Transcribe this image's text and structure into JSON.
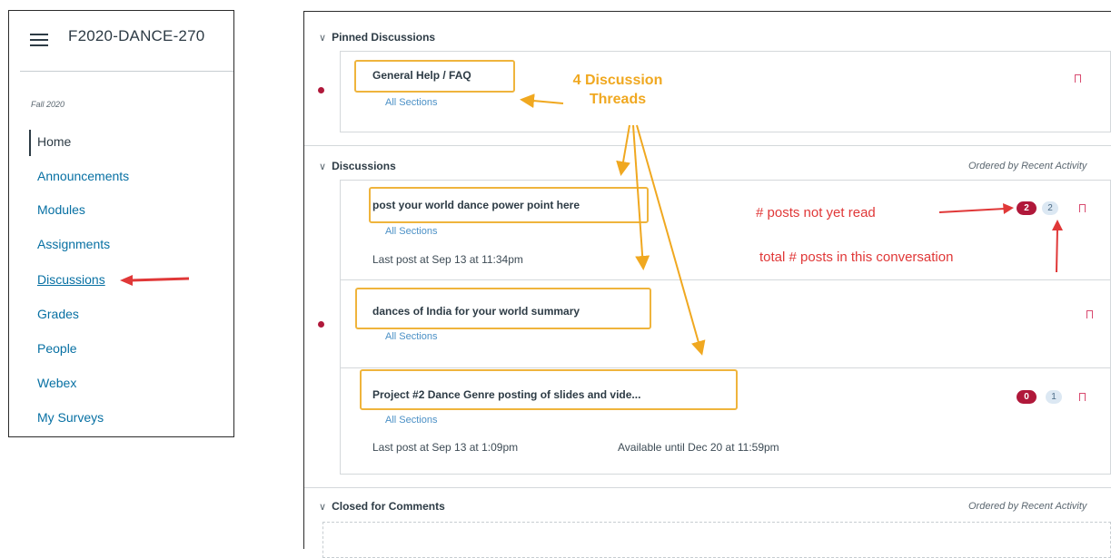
{
  "sidebar": {
    "course_title": "F2020-DANCE-270",
    "term": "Fall 2020",
    "items": [
      {
        "label": "Home"
      },
      {
        "label": "Announcements"
      },
      {
        "label": "Modules"
      },
      {
        "label": "Assignments"
      },
      {
        "label": "Discussions"
      },
      {
        "label": "Grades"
      },
      {
        "label": "People"
      },
      {
        "label": "Webex"
      },
      {
        "label": "My Surveys"
      }
    ]
  },
  "main": {
    "pinned": {
      "heading": "Pinned Discussions",
      "items": [
        {
          "title": "General Help / FAQ",
          "sections": "All Sections"
        }
      ]
    },
    "discussions": {
      "heading": "Discussions",
      "order_note": "Ordered by Recent Activity",
      "items": [
        {
          "title": "post your world dance power point here",
          "sections": "All Sections",
          "last_post": "Last post at Sep 13 at 11:34pm",
          "unread": "2",
          "total": "2"
        },
        {
          "title": "dances of India for your world summary",
          "sections": "All Sections"
        },
        {
          "title": "Project #2 Dance Genre posting of slides and vide...",
          "sections": "All Sections",
          "last_post": "Last post at Sep 13 at 1:09pm",
          "available": "Available until Dec 20 at 11:59pm",
          "unread": "0",
          "total": "1"
        }
      ]
    },
    "closed": {
      "heading": "Closed for Comments",
      "order_note": "Ordered by Recent Activity"
    }
  },
  "annotations": {
    "threads_label": "4 Discussion\nThreads",
    "unread_label": "# posts not yet read",
    "total_label": "total # posts in this conversation"
  },
  "colors": {
    "highlight": "#efb43c",
    "annotation_red": "#e03838",
    "unread_badge": "#b0183a",
    "link": "#0770a3"
  }
}
